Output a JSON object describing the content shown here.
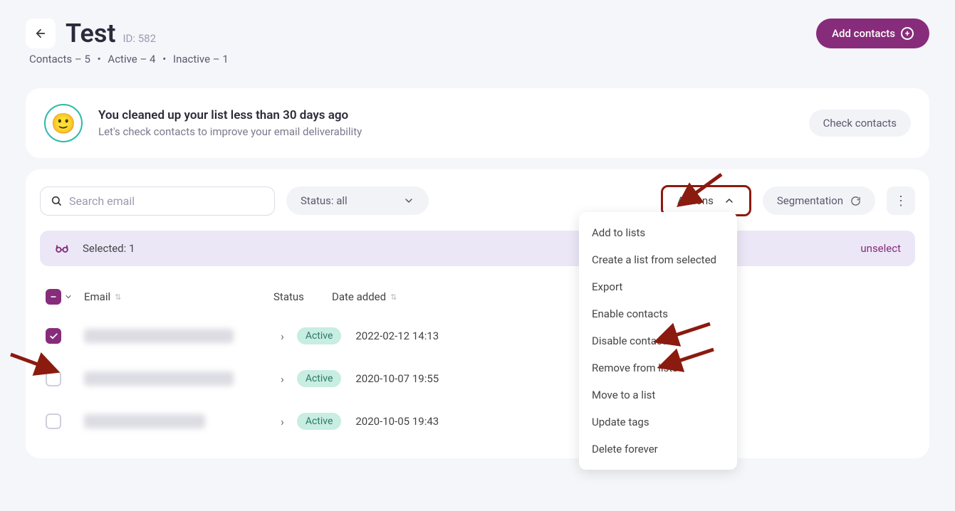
{
  "header": {
    "title": "Test",
    "id_label": "ID: 582",
    "add_button": "Add contacts"
  },
  "stats": {
    "contacts": "Contacts – 5",
    "active": "Active – 4",
    "inactive": "Inactive – 1"
  },
  "banner": {
    "title": "You cleaned up your list less than 30 days ago",
    "subtitle": "Let's check contacts to improve your email deliverability",
    "button": "Check contacts"
  },
  "toolbar": {
    "search_placeholder": "Search email",
    "status_label": "Status: all",
    "actions_label": "Actions",
    "segmentation_label": "Segmentation"
  },
  "selection": {
    "label": "Selected: 1",
    "unselect": "unselect"
  },
  "columns": {
    "email": "Email",
    "status": "Status",
    "date": "Date added"
  },
  "rows": [
    {
      "checked": true,
      "status": "Active",
      "date": "2022-02-12 14:13"
    },
    {
      "checked": false,
      "status": "Active",
      "date": "2020-10-07 19:55"
    },
    {
      "checked": false,
      "status": "Active",
      "date": "2020-10-05 19:43"
    }
  ],
  "actions_menu": [
    "Add to lists",
    "Create a list from selected",
    "Export",
    "Enable contacts",
    "Disable contacts",
    "Remove from lists",
    "Move to a list",
    "Update tags",
    "Delete forever"
  ]
}
